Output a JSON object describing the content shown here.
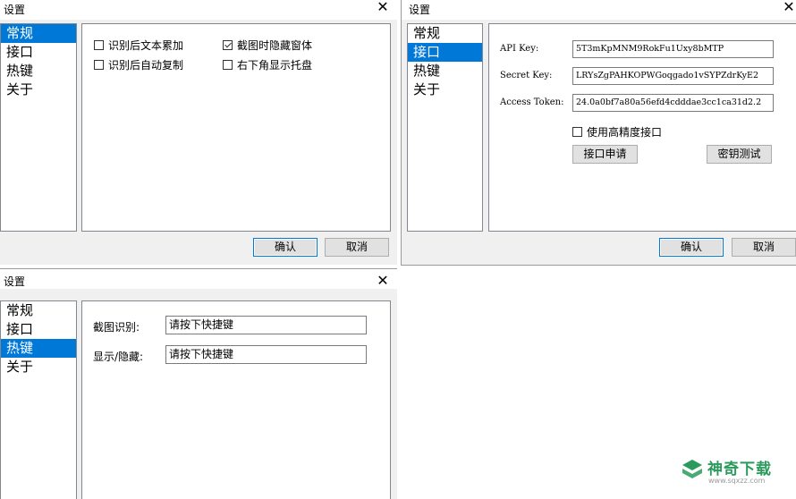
{
  "dialogs": {
    "general": {
      "title": "设置",
      "close_glyph": "✕",
      "nav": [
        "常规",
        "接口",
        "热键",
        "关于"
      ],
      "options": [
        {
          "label": "识别后文本累加",
          "checked": false
        },
        {
          "label": "截图时隐藏窗体",
          "checked": true
        },
        {
          "label": "识别后自动复制",
          "checked": false
        },
        {
          "label": "右下角显示托盘",
          "checked": false
        }
      ],
      "ok_label": "确认",
      "cancel_label": "取消"
    },
    "api": {
      "title": "设置",
      "close_glyph": "✕",
      "nav": [
        "常规",
        "接口",
        "热键",
        "关于"
      ],
      "api_key_label": "API Key:",
      "api_key_value": "5T3mKpMNM9RokFu1Uxy8bMTP",
      "secret_key_label": "Secret Key:",
      "secret_key_value": "LRYsZgPAHKOPWGoqgado1vSYPZdrKyE2",
      "access_token_label": "Access Token:",
      "access_token_value": "24.0a0bf7a80a56efd4cdddae3cc1ca31d2.2",
      "high_precision_label": "使用高精度接口",
      "high_precision_checked": false,
      "apply_label": "接口申请",
      "test_label": "密钥测试",
      "ok_label": "确认",
      "cancel_label": "取消"
    },
    "hotkey": {
      "title": "设置",
      "close_glyph": "✕",
      "nav": [
        "常规",
        "接口",
        "热键",
        "关于"
      ],
      "screenshot_label": "截图识别:",
      "screenshot_value": "请按下快捷键",
      "toggle_label": "显示/隐藏:",
      "toggle_value": "请按下快捷键"
    }
  },
  "watermark": {
    "name": "神奇下载",
    "url": "www.sqxzz.com",
    "color": "#2a9b5c"
  }
}
